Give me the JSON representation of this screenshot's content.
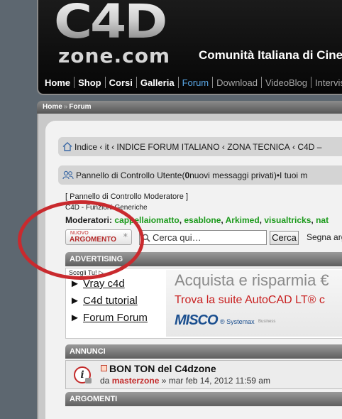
{
  "header": {
    "logo_main": "C4D",
    "logo_sub": "zone.com",
    "tagline": "Comunità Italiana di Cine",
    "nav": [
      {
        "label": "Home",
        "state": "normal"
      },
      {
        "label": "Shop",
        "state": "normal"
      },
      {
        "label": "Corsi",
        "state": "normal"
      },
      {
        "label": "Galleria",
        "state": "normal"
      },
      {
        "label": "Forum",
        "state": "active"
      },
      {
        "label": "Download",
        "state": "dim"
      },
      {
        "label": "VideoBlog",
        "state": "dim"
      },
      {
        "label": "Intervis",
        "state": "dim"
      }
    ]
  },
  "breadcrumb": {
    "home": "Home",
    "separator": "»",
    "forum": "Forum"
  },
  "navpath": {
    "index": "Indice",
    "separator": "‹",
    "it": "it",
    "indice_it": "INDICE FORUM ITALIANO",
    "zona": "ZONA TECNICA",
    "c4d": "C4D –"
  },
  "ucp": {
    "link": "Pannello di Controllo Utente",
    "count_open": " (",
    "count": "0",
    "count_text": " nuovi messaggi privati)",
    "bullet": " • ",
    "more": "I tuoi m"
  },
  "forum": {
    "mcp_link": "[ Pannello di Controllo Moderatore ]",
    "description": "C4D - Funzioni Generiche",
    "moderators_label": "Moderatori:",
    "moderators": [
      "cappellaiomatto",
      "esablone",
      "Arkimed",
      "visualtricks",
      "nat"
    ]
  },
  "actions": {
    "new_topic_small": "NUOVO",
    "new_topic_big": "ARGOMENTO",
    "new_topic_star": "*",
    "search_placeholder": "Cerca qui…",
    "search_button": "Cerca",
    "mark_read": "Segna arg"
  },
  "advertising": {
    "heading": "ADVERTISING",
    "choose": "Scegli Tu! ▷",
    "links": [
      "Vray c4d",
      "C4d tutorial",
      "Forum Forum"
    ],
    "link_bullet": "►",
    "banner_line1": "Acquista e risparmia €",
    "banner_line2": "Trova la suite AutoCAD LT® c",
    "brand": "MISCO",
    "brand_sub": "® Systemax",
    "brand_sub2": "Business"
  },
  "announcements": {
    "heading": "ANNUNCI",
    "title": "BON TON del C4dzone",
    "by": "da ",
    "author": "masterzone",
    "date": " » mar feb 14, 2012 11:59 am"
  },
  "topics": {
    "heading": "ARGOMENTI"
  }
}
